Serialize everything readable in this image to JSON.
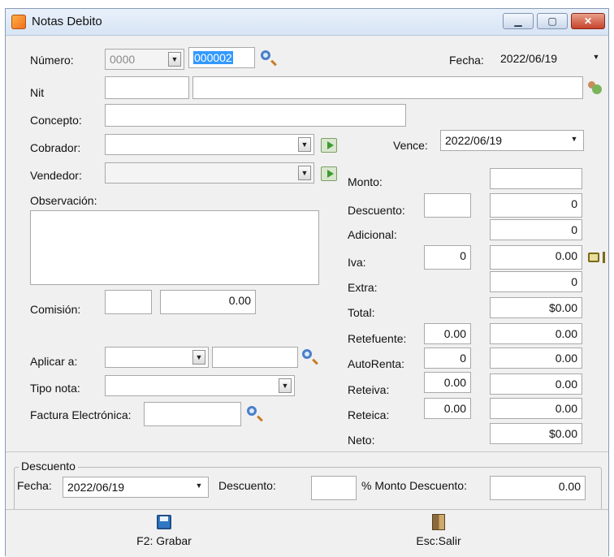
{
  "window": {
    "title": "Notas Debito",
    "min_glyph": "▁",
    "max_glyph": "▢",
    "close_glyph": "✕"
  },
  "icons": {
    "search": "search-icon",
    "go": "go-arrow-icon",
    "users": "users-icon",
    "calculator": "calculator-icon",
    "save": "save-icon",
    "exit": "door-icon"
  },
  "form": {
    "numero": {
      "label": "Número:",
      "prefix": "0000",
      "value": "000002"
    },
    "fecha": {
      "label": "Fecha:",
      "value": "2022/06/19"
    },
    "nit": {
      "label": "Nit",
      "value": "",
      "name": ""
    },
    "concepto": {
      "label": "Concepto:",
      "value": ""
    },
    "cobrador": {
      "label": "Cobrador:",
      "value": ""
    },
    "vence": {
      "label": "Vence:",
      "value": "2022/06/19"
    },
    "vendedor": {
      "label": "Vendedor:",
      "value": ""
    },
    "observacion": {
      "label": "Observación:",
      "value": ""
    },
    "comision": {
      "label": "Comisión:",
      "percent": "",
      "value": "0.00"
    },
    "aplicar": {
      "label": "Aplicar a:",
      "type": "",
      "value": ""
    },
    "tipo_nota": {
      "label": "Tipo nota:",
      "value": ""
    },
    "factura": {
      "label": "Factura Electrónica:",
      "value": ""
    }
  },
  "totals": {
    "monto": {
      "label": "Monto:",
      "value": ""
    },
    "descuento": {
      "label": "Descuento:",
      "pct": "",
      "value": "0"
    },
    "adicional": {
      "label": "Adicional:",
      "value": "0"
    },
    "iva": {
      "label": "Iva:",
      "pct": "0",
      "value": "0.00"
    },
    "extra": {
      "label": "Extra:",
      "value": "0"
    },
    "total": {
      "label": "Total:",
      "value": "$0.00"
    },
    "retefuente": {
      "label": "Retefuente:",
      "pct": "0.00",
      "value": "0.00"
    },
    "autorenta": {
      "label": "AutoRenta:",
      "pct": "0",
      "value": "0.00"
    },
    "reteiva": {
      "label": "Reteiva:",
      "pct": "0.00",
      "value": "0.00"
    },
    "reteica": {
      "label": "Reteica:",
      "pct": "0.00",
      "value": "0.00"
    },
    "neto": {
      "label": "Neto:",
      "value": "$0.00"
    }
  },
  "descuento_group": {
    "title": "Descuento",
    "fecha_label": "Fecha:",
    "fecha_value": "2022/06/19",
    "descuento_label": "Descuento:",
    "descuento_value": "",
    "monto_label": "% Monto Descuento:",
    "monto_value": "0.00"
  },
  "toolbar": {
    "save": "F2: Grabar",
    "exit": "Esc:Salir"
  }
}
